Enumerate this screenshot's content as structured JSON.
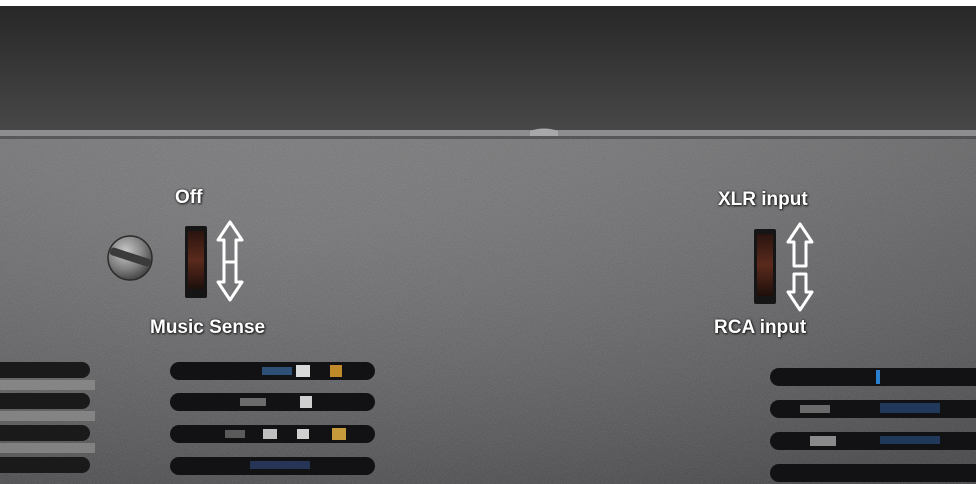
{
  "labels": {
    "off": "Off",
    "music_sense": "Music Sense",
    "xlr_input": "XLR input",
    "rca_input": "RCA input"
  }
}
